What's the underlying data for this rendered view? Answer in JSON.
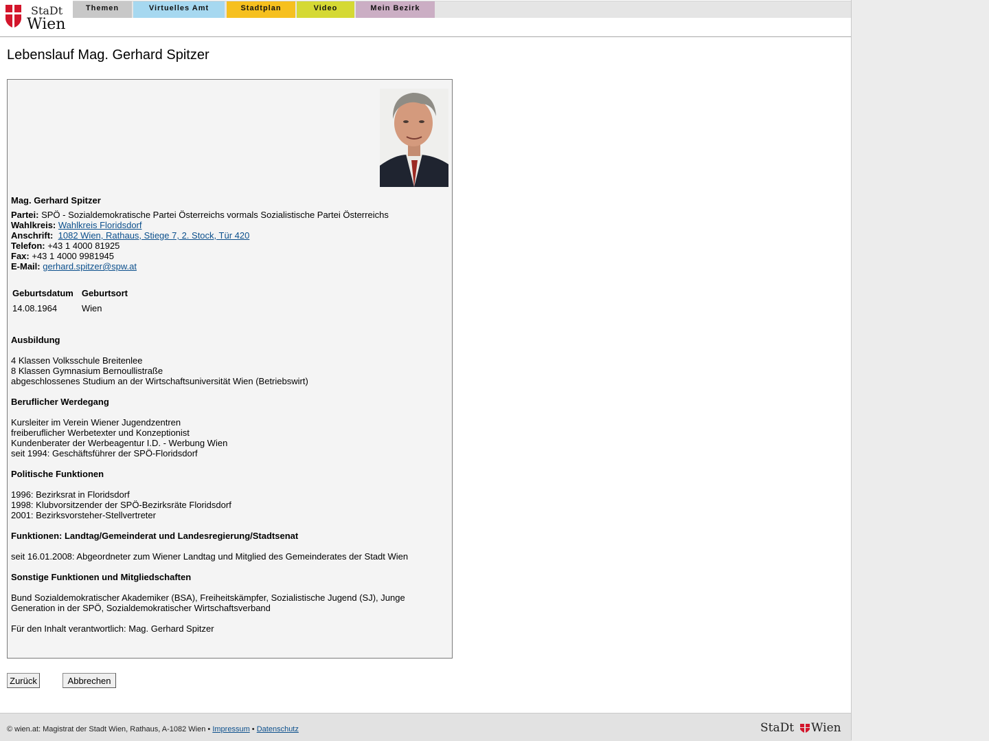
{
  "header": {
    "logo_top": "StaDt",
    "logo_bottom": "Wien",
    "nav": [
      {
        "label": "Themen",
        "color": "#c8c8c8"
      },
      {
        "label": "Virtuelles Amt",
        "color": "#a6d8f0"
      },
      {
        "label": "Stadtplan",
        "color": "#f6c01f"
      },
      {
        "label": "Video",
        "color": "#d5d934"
      },
      {
        "label": "Mein Bezirk",
        "color": "#cbaec4"
      }
    ]
  },
  "page_title": "Lebenslauf Mag. Gerhard Spitzer",
  "profile": {
    "name": "Mag. Gerhard Spitzer",
    "partei_label": "Partei:",
    "partei": "SPÖ - Sozialdemokratische Partei Österreichs vormals Sozialistische Partei Österreichs",
    "wahlkreis_label": "Wahlkreis:",
    "wahlkreis": "Wahlkreis Floridsdorf",
    "anschrift_label": "Anschrift:",
    "anschrift": "1082 Wien, Rathaus, Stiege 7, 2. Stock, Tür 420",
    "telefon_label": "Telefon:",
    "telefon": "+43 1 4000 81925",
    "fax_label": "Fax:",
    "fax": "+43 1 4000 9981945",
    "email_label": "E-Mail:",
    "email": "gerhard.spitzer@spw.at",
    "birth": {
      "headers": [
        "Geburtsdatum",
        "Geburtsort"
      ],
      "values": [
        "14.08.1964",
        "Wien"
      ]
    }
  },
  "sections": [
    {
      "title": "Ausbildung",
      "lines": [
        "4 Klassen Volksschule Breitenlee",
        "8 Klassen Gymnasium Bernoullistraße",
        "abgeschlossenes Studium an der Wirtschaftsuniversität Wien (Betriebswirt)"
      ]
    },
    {
      "title": "Beruflicher Werdegang",
      "lines": [
        "Kursleiter im Verein Wiener Jugendzentren",
        "freiberuflicher Werbetexter und Konzeptionist",
        "Kundenberater der Werbeagentur I.D. - Werbung Wien",
        "seit 1994: Geschäftsführer der SPÖ-Floridsdorf"
      ]
    },
    {
      "title": "Politische Funktionen",
      "lines": [
        "1996: Bezirksrat in Floridsdorf",
        "1998: Klubvorsitzender der SPÖ-Bezirksräte Floridsdorf",
        "2001: Bezirksvorsteher-Stellvertreter"
      ]
    },
    {
      "title": "Funktionen: Landtag/Gemeinderat und Landesregierung/Stadtsenat",
      "lines": [
        "seit 16.01.2008: Abgeordneter zum Wiener Landtag und Mitglied des Gemeinderates der Stadt Wien"
      ]
    },
    {
      "title": "Sonstige Funktionen und Mitgliedschaften",
      "lines": [
        "Bund Sozialdemokratischer Akademiker (BSA), Freiheitskämpfer, Sozialistische Jugend (SJ), Junge",
        "Generation in der SPÖ, Sozialdemokratischer Wirtschaftsverband"
      ]
    }
  ],
  "responsible": "Für den Inhalt verantwortlich: Mag. Gerhard Spitzer",
  "buttons": {
    "back": "Zurück",
    "cancel": "Abbrechen"
  },
  "footer": {
    "text": "© wien.at: Magistrat der Stadt Wien, Rathaus, A-1082 Wien •",
    "impressum": "Impressum",
    "separator": "•",
    "datenschutz": "Datenschutz",
    "logo_left": "StaDt",
    "logo_right": "Wien"
  }
}
